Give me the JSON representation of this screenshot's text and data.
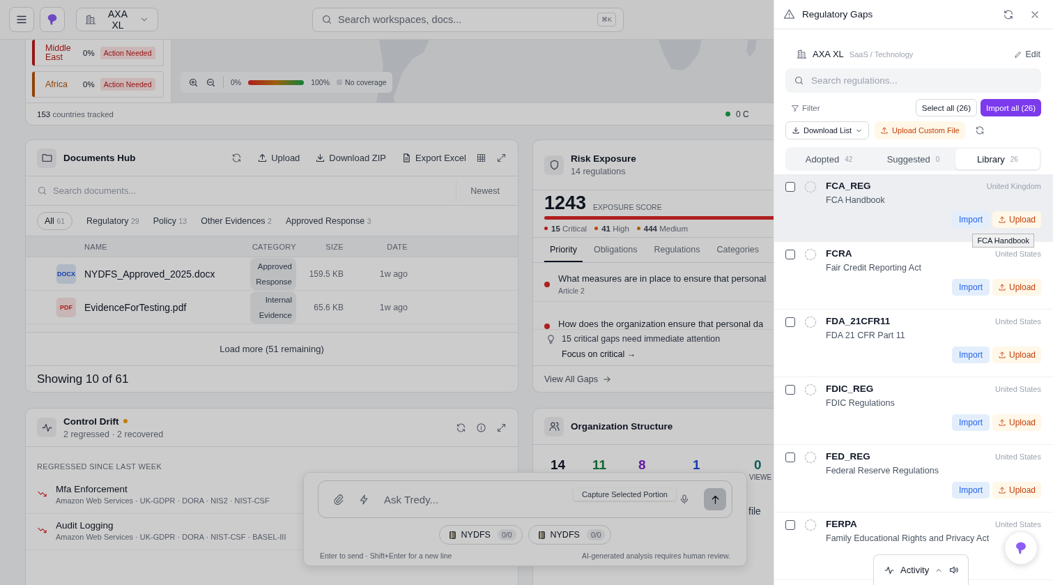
{
  "header": {
    "workspace": "AXA XL",
    "search_placeholder": "Search workspaces, docs...",
    "shortcut": "⌘K"
  },
  "coverage": {
    "regions": [
      {
        "name": "Middle East",
        "percent": "0%",
        "status": "Action Needed",
        "color": "#941616"
      },
      {
        "name": "Africa",
        "percent": "0%",
        "status": "Action Needed",
        "color": "#904207"
      }
    ],
    "legend": {
      "min": "0%",
      "max": "100%",
      "no_coverage": "No coverage"
    },
    "tracked_count": "153",
    "tracked_label": "countries tracked",
    "legend_count": "0 C"
  },
  "documents_hub": {
    "title": "Documents Hub",
    "actions": [
      "Upload",
      "Download ZIP",
      "Export Excel"
    ],
    "search_placeholder": "Search documents...",
    "sort": "Newest",
    "filters": [
      {
        "label": "All",
        "count": "61",
        "selected": true
      },
      {
        "label": "Regulatory",
        "count": "29",
        "selected": false
      },
      {
        "label": "Policy",
        "count": "13",
        "selected": false
      },
      {
        "label": "Other Evidences",
        "count": "2",
        "selected": false
      },
      {
        "label": "Approved Response",
        "count": "3",
        "selected": false
      }
    ],
    "columns": [
      "NAME",
      "CATEGORY",
      "SIZE",
      "DATE"
    ],
    "rows": [
      {
        "kind": "docx",
        "badge": "DOCX",
        "name": "NYDFS_Approved_2025.docx",
        "category": "Approved Response",
        "size": "159.5 KB",
        "date": "1w ago"
      },
      {
        "kind": "pdf",
        "badge": "PDF",
        "name": "EvidenceForTesting.pdf",
        "category": "Internal Evidence",
        "size": "65.6 KB",
        "date": "1w ago"
      }
    ],
    "load_more": "Load more (51 remaining)",
    "showing": "Showing 10 of 61"
  },
  "risk_exposure": {
    "title": "Risk Exposure",
    "subtitle": "14 regulations",
    "score": "1243",
    "score_label": "EXPOSURE SCORE",
    "severities": [
      {
        "count": "15",
        "label": "Critical",
        "color": "#b01e1e"
      },
      {
        "count": "41",
        "label": "High",
        "color": "#bb460a"
      },
      {
        "count": "444",
        "label": "Medium",
        "color": "#ae5f05"
      }
    ],
    "tabs": [
      {
        "label": "Priority",
        "selected": true
      },
      {
        "label": "Obligations",
        "selected": false
      },
      {
        "label": "Regulations",
        "selected": false
      },
      {
        "label": "Categories",
        "selected": false
      }
    ],
    "gaps": [
      {
        "question": "What measures are in place to ensure that personal",
        "reference": "Article 2"
      },
      {
        "question": "How does the organization ensure that personal da"
      }
    ],
    "tip": "15 critical gaps need immediate attention",
    "tip_link": "Focus on critical →",
    "view_all": "View All Gaps"
  },
  "control_drift": {
    "title": "Control Drift",
    "subtitle": "2 regressed · 2 recovered",
    "section": "REGRESSED SINCE LAST WEEK",
    "items": [
      {
        "name": "Mfa Enforcement",
        "detail": "Amazon Web Services · UK-GDPR · DORA · NIS2 · NIST-CSF"
      },
      {
        "name": "Audit Logging",
        "detail": "Amazon Web Services · UK-GDPR · DORA · NIST-CSF · BASEL-III"
      }
    ]
  },
  "organization": {
    "title": "Organization Structure",
    "stats": [
      {
        "value": "14",
        "color": "#0e131f"
      },
      {
        "value": "11",
        "color": "#116631"
      },
      {
        "value": "8",
        "color": "#651ba5"
      },
      {
        "value": "1",
        "color": "#173ead"
      },
      {
        "value": "0",
        "color": "#0c5e58",
        "label": "VIEWE"
      }
    ],
    "fragment": "file"
  },
  "chat": {
    "placeholder": "Ask Tredy...",
    "tooltip": "Capture Selected Portion",
    "chips": [
      {
        "label": "NYDFS",
        "count": "0/0"
      },
      {
        "label": "NYDFS",
        "count": "0/0"
      }
    ],
    "hint": "Enter to send · Shift+Enter for a new line",
    "disclaimer": "AI-generated analysis requires human review."
  },
  "drawer": {
    "title": "Regulatory Gaps",
    "org": "AXA XL",
    "sector": "SaaS / Technology",
    "edit": "Edit",
    "search_placeholder": "Search regulations...",
    "filter": "Filter",
    "select_all": "Select all (26)",
    "import_all": "Import all (26)",
    "download": "Download List",
    "upload_custom": "Upload Custom File",
    "tabs": [
      {
        "label": "Adopted",
        "count": "42",
        "selected": false
      },
      {
        "label": "Suggested",
        "count": "0",
        "selected": false
      },
      {
        "label": "Library",
        "count": "26",
        "selected": true
      }
    ],
    "regulations": [
      {
        "code": "FCA_REG",
        "name": "FCA Handbook",
        "country": "United Kingdom",
        "checked": false,
        "highlighted": true,
        "actions": [
          "Import",
          "Upload"
        ],
        "tooltip": "FCA Handbook"
      },
      {
        "code": "FCRA",
        "name": "Fair Credit Reporting Act",
        "country": "United States",
        "checked": false,
        "highlighted": false,
        "actions": [
          "Import",
          "Upload"
        ]
      },
      {
        "code": "FDA_21CFR11",
        "name": "FDA 21 CFR Part 11",
        "country": "United States",
        "checked": false,
        "highlighted": false,
        "actions": [
          "Import",
          "Upload"
        ]
      },
      {
        "code": "FDIC_REG",
        "name": "FDIC Regulations",
        "country": "United States",
        "checked": false,
        "highlighted": false,
        "actions": [
          "Import",
          "Upload"
        ]
      },
      {
        "code": "FED_REG",
        "name": "Federal Reserve Regulations",
        "country": "United States",
        "checked": false,
        "highlighted": false,
        "actions": [
          "Import",
          "Upload"
        ]
      },
      {
        "code": "FERPA",
        "name": "Family Educational Rights and Privacy Act",
        "country": "United States",
        "checked": false,
        "highlighted": false
      }
    ]
  },
  "activity": {
    "label": "Activity"
  }
}
